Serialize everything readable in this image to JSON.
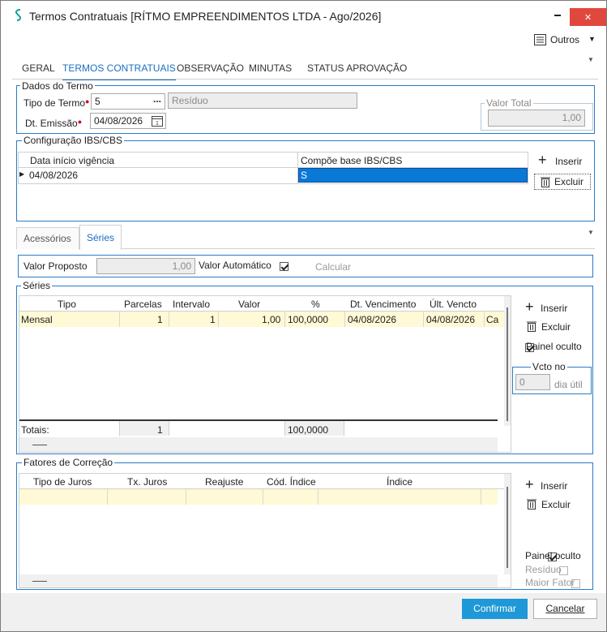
{
  "window": {
    "title": "Termos Contratuais [RÍTMO EMPREENDIMENTOS LTDA - Ago/2026]",
    "minimize_symbol": "▬",
    "maximize_symbol": "□",
    "close_symbol": "✕"
  },
  "toolbar": {
    "outros_label": "Outros"
  },
  "tabs": [
    "GERAL",
    "TERMOS CONTRATUAIS",
    "OBSERVAÇÃO",
    "MINUTAS",
    "STATUS APROVAÇÃO"
  ],
  "dados_termo": {
    "group_title": "Dados do Termo",
    "tipo_termo_label": "Tipo de Termo",
    "tipo_termo_value": "5",
    "tipo_termo_desc": "Resíduo",
    "dt_emissao_label": "Dt. Emissão",
    "dt_emissao_value": "04/08/2026",
    "valor_total_label": "Valor Total",
    "valor_total_value": "1,00",
    "ellipsis": "..."
  },
  "config_ibs": {
    "group_title": "Configuração IBS/CBS",
    "columns": [
      "Data início vigência",
      "Compõe base IBS/CBS"
    ],
    "row": {
      "data": "04/08/2026",
      "compoe": "S"
    },
    "inserir_label": "Inserir",
    "excluir_label": "Excluir"
  },
  "subtabs": [
    "Acessórios",
    "Séries"
  ],
  "valor_proposto": {
    "label": "Valor Proposto",
    "value": "1,00",
    "auto_label": "Valor Automático",
    "calcular_label": "Calcular"
  },
  "series": {
    "group_title": "Séries",
    "columns": [
      "Tipo",
      "Parcelas",
      "Intervalo",
      "Valor",
      "%",
      "Dt. Vencimento",
      "Últ. Vencto"
    ],
    "row": [
      "Mensal",
      "1",
      "1",
      "1,00",
      "100,0000",
      "04/08/2026",
      "04/08/2026",
      "Ca"
    ],
    "totais_label": "Totais:",
    "totais_parcelas": "1",
    "totais_percent": "100,0000",
    "inserir_label": "Inserir",
    "excluir_label": "Excluir",
    "painel_oculto_label": "Painel oculto",
    "vcto_label": "Vcto no",
    "vcto_value": "0",
    "dia_util_label": "dia útil"
  },
  "fatores": {
    "group_title": "Fatores de Correção",
    "columns": [
      "Tipo de Juros",
      "Tx. Juros",
      "Reajuste",
      "Cód. Índice",
      "Índice"
    ],
    "inserir_label": "Inserir",
    "excluir_label": "Excluir",
    "painel_oculto_label": "Painel oculto",
    "residuo_label": "Resíduo",
    "maior_fator_label": "Maior Fator"
  },
  "footer": {
    "confirmar_label": "Confirmar",
    "cancelar_label": "Cancelar"
  },
  "colors": {
    "accent": "#1a6fc0",
    "border_blue": "#2a7cc7",
    "primary_button": "#1e98d6",
    "row_highlight": "#fff9d6",
    "selection": "#0a78d7"
  }
}
